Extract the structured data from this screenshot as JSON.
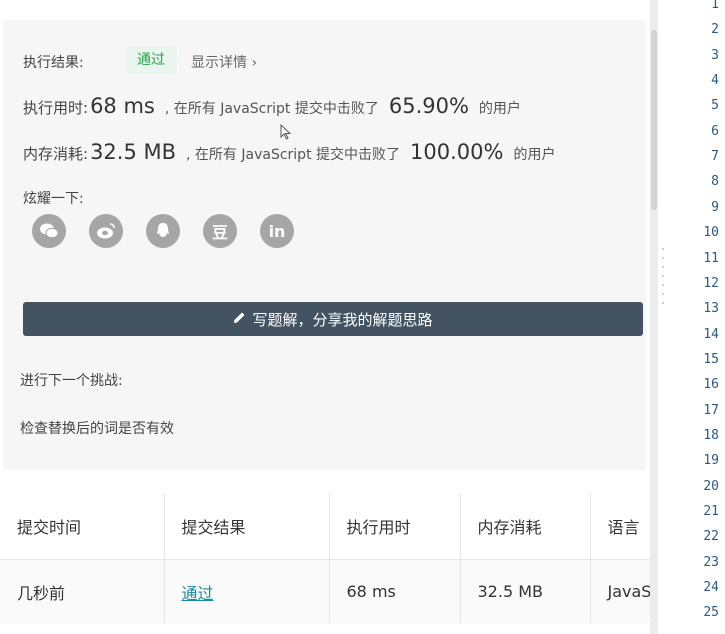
{
  "result": {
    "status_label": "执行结果:",
    "status_badge": "通过",
    "details_link": "显示详情 ›",
    "runtime_label": "执行用时:",
    "runtime_value": "68 ms",
    "runtime_mid": ", 在所有 JavaScript 提交中击败了",
    "runtime_pct": "65.90%",
    "runtime_suffix": "的用户",
    "memory_label": "内存消耗:",
    "memory_value": "32.5 MB",
    "memory_mid": ", 在所有 JavaScript 提交中击败了",
    "memory_pct": "100.00%",
    "memory_suffix": "的用户",
    "share_label": "炫耀一下:",
    "share_icons": [
      "wechat-icon",
      "weibo-icon",
      "qq-icon",
      "douban-icon",
      "linkedin-icon"
    ],
    "douban_glyph": "豆",
    "linkedin_glyph": "in",
    "write_button": "写题解，分享我的解题思路",
    "next_challenge_label": "进行下一个挑战:",
    "next_challenge_item": "检查替换后的词是否有效"
  },
  "table": {
    "headers": [
      "提交时间",
      "提交结果",
      "执行用时",
      "内存消耗",
      "语言"
    ],
    "rows": [
      [
        "几秒前",
        "通过",
        "68 ms",
        "32.5 MB",
        "JavaScript"
      ]
    ]
  },
  "editor": {
    "line_numbers": [
      "1",
      "2",
      "3",
      "4",
      "5",
      "6",
      "7",
      "8",
      "9",
      "10",
      "11",
      "12",
      "13",
      "14",
      "15",
      "16",
      "17",
      "18",
      "19",
      "20",
      "21",
      "22",
      "23",
      "24",
      "25"
    ]
  },
  "colors": {
    "accent_green": "#2da44e",
    "button_bg": "#435361",
    "link_teal": "#1a8ba3",
    "line_number": "#2c5a83"
  }
}
